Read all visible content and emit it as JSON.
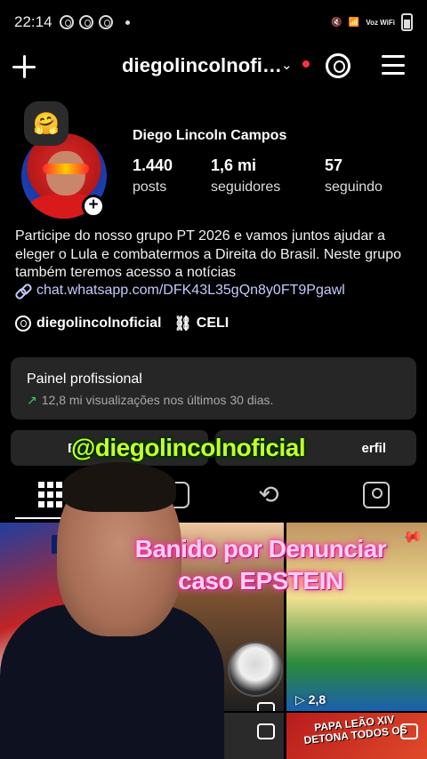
{
  "status_bar": {
    "time": "22:14",
    "net_label": "Voz WiFi",
    "notification_icons": [
      "threads-icon",
      "threads-icon",
      "threads-icon"
    ]
  },
  "header": {
    "username": "diegolincolnofi…",
    "chevron": "⌄"
  },
  "profile": {
    "note_emoji": "🤗",
    "full_name": "Diego Lincoln Campos",
    "stats": [
      {
        "value": "1.440",
        "label": "posts"
      },
      {
        "value": "1,6 mi",
        "label": "seguidores"
      },
      {
        "value": "57",
        "label": "seguindo"
      }
    ],
    "bio": "Participe do nosso grupo PT 2026 e vamos juntos ajudar a eleger o Lula e combatermos a Direita do Brasil. Neste grupo também teremos acesso a notícias",
    "link": "chat.whatsapp.com/DFK43L35gQn8y0FT9Pgawl",
    "threads_handle": "diegolincolnoficial",
    "chip_label": "CELI"
  },
  "panel": {
    "title": "Painel profissional",
    "subtitle": "12,8 mi visualizações nos últimos 30 dias."
  },
  "buttons": {
    "left_visible": "E",
    "right_visible": "erfil"
  },
  "overlay": {
    "handle": "@diegolincolnoficial",
    "title_line1": "Banido por Denunciar",
    "title_line2": "caso EPSTEIN"
  },
  "grid": {
    "thumb1_label": "N",
    "thumb3_views": "2,8",
    "thumb5_text": "PAPA LEÃO XIV DETONA TODOS OS"
  },
  "colors": {
    "accent_link": "#c3cbff",
    "handle_green": "#c6ff2c",
    "title_pink": "#ffd0f0",
    "live_dot": "#ff3040"
  }
}
